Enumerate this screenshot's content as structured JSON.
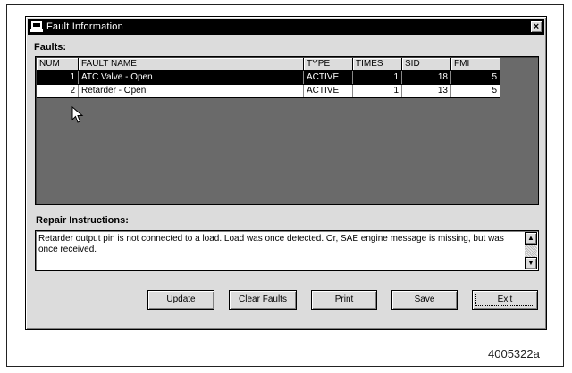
{
  "window": {
    "title": "Fault Information",
    "close_label": "×"
  },
  "faults": {
    "label": "Faults:",
    "columns": [
      "NUM",
      "FAULT NAME",
      "TYPE",
      "TIMES",
      "SID",
      "FMI"
    ],
    "rows": [
      {
        "num": "1",
        "name": "ATC Valve - Open",
        "type": "ACTIVE",
        "times": "1",
        "sid": "18",
        "fmi": "5",
        "selected": true
      },
      {
        "num": "2",
        "name": "Retarder - Open",
        "type": "ACTIVE",
        "times": "1",
        "sid": "13",
        "fmi": "5",
        "selected": false
      }
    ]
  },
  "repair": {
    "label": "Repair Instructions:",
    "text": "Retarder output pin is not connected to a load. Load was once detected. Or, SAE engine message is missing, but was once received."
  },
  "buttons": {
    "update": "Update",
    "clear_faults": "Clear Faults",
    "print": "Print",
    "save": "Save",
    "exit": "Exit"
  },
  "caption": "4005322a"
}
